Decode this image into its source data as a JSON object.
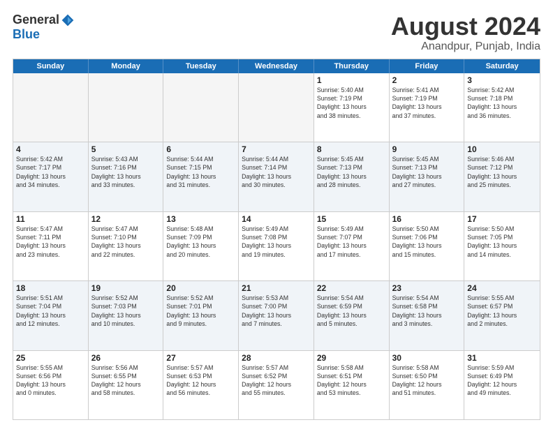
{
  "logo": {
    "general": "General",
    "blue": "Blue"
  },
  "title": "August 2024",
  "subtitle": "Anandpur, Punjab, India",
  "header_days": [
    "Sunday",
    "Monday",
    "Tuesday",
    "Wednesday",
    "Thursday",
    "Friday",
    "Saturday"
  ],
  "rows": [
    [
      {
        "day": "",
        "info": "",
        "empty": true
      },
      {
        "day": "",
        "info": "",
        "empty": true
      },
      {
        "day": "",
        "info": "",
        "empty": true
      },
      {
        "day": "",
        "info": "",
        "empty": true
      },
      {
        "day": "1",
        "info": "Sunrise: 5:40 AM\nSunset: 7:19 PM\nDaylight: 13 hours\nand 38 minutes."
      },
      {
        "day": "2",
        "info": "Sunrise: 5:41 AM\nSunset: 7:19 PM\nDaylight: 13 hours\nand 37 minutes."
      },
      {
        "day": "3",
        "info": "Sunrise: 5:42 AM\nSunset: 7:18 PM\nDaylight: 13 hours\nand 36 minutes."
      }
    ],
    [
      {
        "day": "4",
        "info": "Sunrise: 5:42 AM\nSunset: 7:17 PM\nDaylight: 13 hours\nand 34 minutes."
      },
      {
        "day": "5",
        "info": "Sunrise: 5:43 AM\nSunset: 7:16 PM\nDaylight: 13 hours\nand 33 minutes."
      },
      {
        "day": "6",
        "info": "Sunrise: 5:44 AM\nSunset: 7:15 PM\nDaylight: 13 hours\nand 31 minutes."
      },
      {
        "day": "7",
        "info": "Sunrise: 5:44 AM\nSunset: 7:14 PM\nDaylight: 13 hours\nand 30 minutes."
      },
      {
        "day": "8",
        "info": "Sunrise: 5:45 AM\nSunset: 7:13 PM\nDaylight: 13 hours\nand 28 minutes."
      },
      {
        "day": "9",
        "info": "Sunrise: 5:45 AM\nSunset: 7:13 PM\nDaylight: 13 hours\nand 27 minutes."
      },
      {
        "day": "10",
        "info": "Sunrise: 5:46 AM\nSunset: 7:12 PM\nDaylight: 13 hours\nand 25 minutes."
      }
    ],
    [
      {
        "day": "11",
        "info": "Sunrise: 5:47 AM\nSunset: 7:11 PM\nDaylight: 13 hours\nand 23 minutes."
      },
      {
        "day": "12",
        "info": "Sunrise: 5:47 AM\nSunset: 7:10 PM\nDaylight: 13 hours\nand 22 minutes."
      },
      {
        "day": "13",
        "info": "Sunrise: 5:48 AM\nSunset: 7:09 PM\nDaylight: 13 hours\nand 20 minutes."
      },
      {
        "day": "14",
        "info": "Sunrise: 5:49 AM\nSunset: 7:08 PM\nDaylight: 13 hours\nand 19 minutes."
      },
      {
        "day": "15",
        "info": "Sunrise: 5:49 AM\nSunset: 7:07 PM\nDaylight: 13 hours\nand 17 minutes."
      },
      {
        "day": "16",
        "info": "Sunrise: 5:50 AM\nSunset: 7:06 PM\nDaylight: 13 hours\nand 15 minutes."
      },
      {
        "day": "17",
        "info": "Sunrise: 5:50 AM\nSunset: 7:05 PM\nDaylight: 13 hours\nand 14 minutes."
      }
    ],
    [
      {
        "day": "18",
        "info": "Sunrise: 5:51 AM\nSunset: 7:04 PM\nDaylight: 13 hours\nand 12 minutes."
      },
      {
        "day": "19",
        "info": "Sunrise: 5:52 AM\nSunset: 7:03 PM\nDaylight: 13 hours\nand 10 minutes."
      },
      {
        "day": "20",
        "info": "Sunrise: 5:52 AM\nSunset: 7:01 PM\nDaylight: 13 hours\nand 9 minutes."
      },
      {
        "day": "21",
        "info": "Sunrise: 5:53 AM\nSunset: 7:00 PM\nDaylight: 13 hours\nand 7 minutes."
      },
      {
        "day": "22",
        "info": "Sunrise: 5:54 AM\nSunset: 6:59 PM\nDaylight: 13 hours\nand 5 minutes."
      },
      {
        "day": "23",
        "info": "Sunrise: 5:54 AM\nSunset: 6:58 PM\nDaylight: 13 hours\nand 3 minutes."
      },
      {
        "day": "24",
        "info": "Sunrise: 5:55 AM\nSunset: 6:57 PM\nDaylight: 13 hours\nand 2 minutes."
      }
    ],
    [
      {
        "day": "25",
        "info": "Sunrise: 5:55 AM\nSunset: 6:56 PM\nDaylight: 13 hours\nand 0 minutes."
      },
      {
        "day": "26",
        "info": "Sunrise: 5:56 AM\nSunset: 6:55 PM\nDaylight: 12 hours\nand 58 minutes."
      },
      {
        "day": "27",
        "info": "Sunrise: 5:57 AM\nSunset: 6:53 PM\nDaylight: 12 hours\nand 56 minutes."
      },
      {
        "day": "28",
        "info": "Sunrise: 5:57 AM\nSunset: 6:52 PM\nDaylight: 12 hours\nand 55 minutes."
      },
      {
        "day": "29",
        "info": "Sunrise: 5:58 AM\nSunset: 6:51 PM\nDaylight: 12 hours\nand 53 minutes."
      },
      {
        "day": "30",
        "info": "Sunrise: 5:58 AM\nSunset: 6:50 PM\nDaylight: 12 hours\nand 51 minutes."
      },
      {
        "day": "31",
        "info": "Sunrise: 5:59 AM\nSunset: 6:49 PM\nDaylight: 12 hours\nand 49 minutes."
      }
    ]
  ]
}
